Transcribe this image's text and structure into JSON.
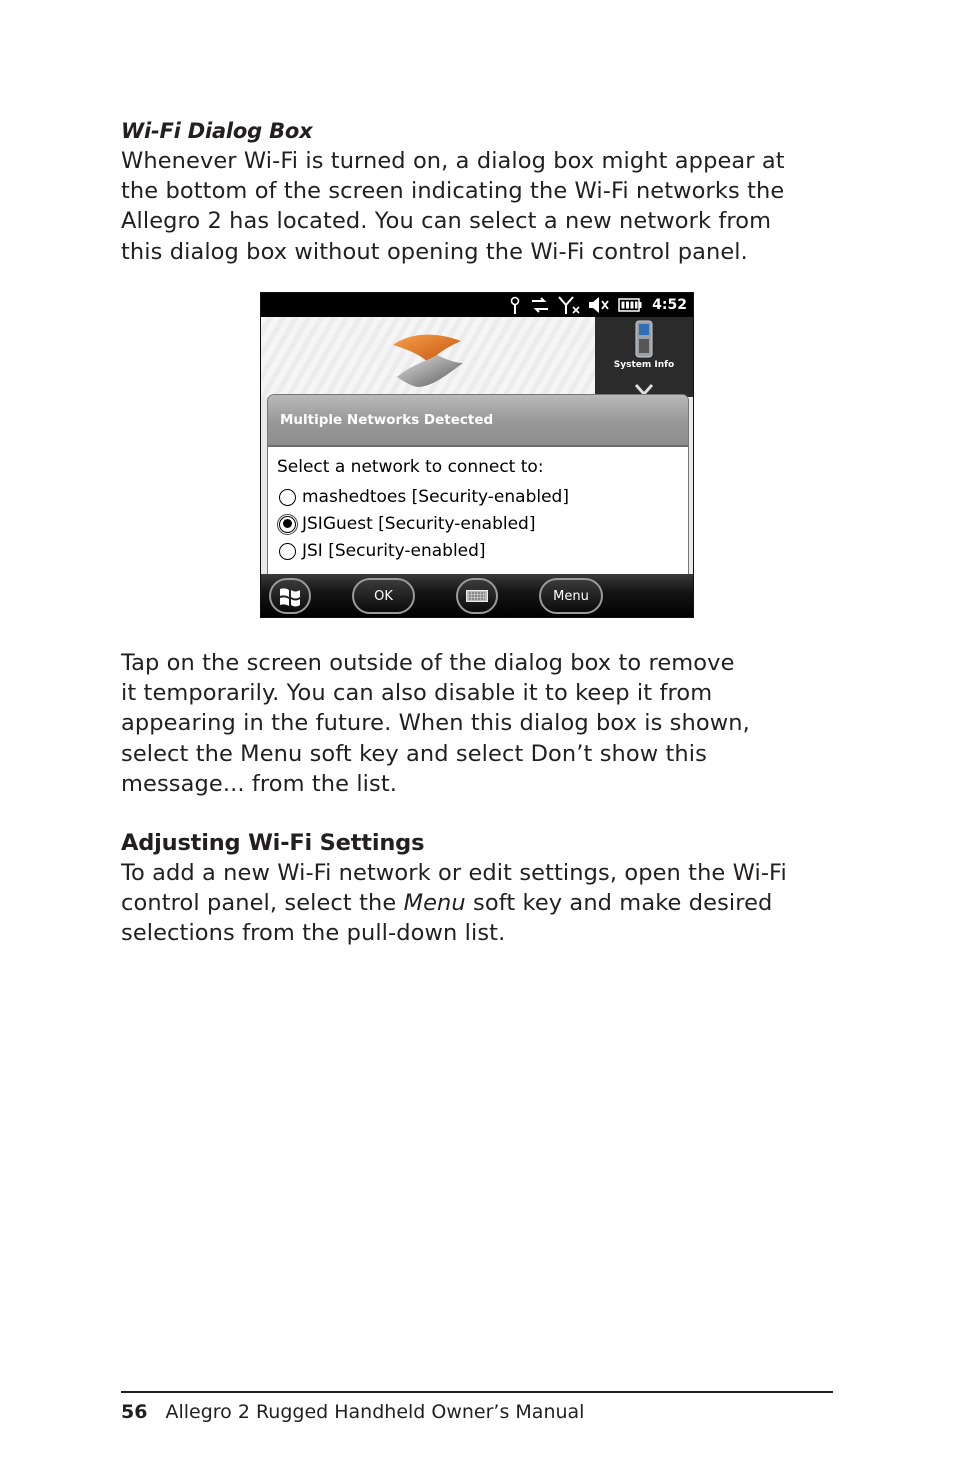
{
  "section": {
    "subheading": "Wi-Fi Dialog Box",
    "paragraph1": "Whenever Wi-Fi is turned on, a dialog box might appear at\nthe bottom of the screen indicating the Wi-Fi networks the\nAllegro 2 has located. You can select a new network from\nthis dialog box without opening the Wi-Fi control panel.",
    "paragraph2": "Tap on the screen outside of the dialog box to remove\nit temporarily. You can also disable it to keep it from\nappearing in the future. When this dialog box is shown,\nselect the Menu soft key and select Don’t show this\nmessage... from the list."
  },
  "section2": {
    "heading": "Adjusting Wi-Fi Settings",
    "p3_before": "To add a new Wi-Fi network or edit settings, open the Wi-Fi\ncontrol panel, select the ",
    "p3_italic": "Menu",
    "p3_after": " soft key and make desired\nselections from the pull-down list."
  },
  "device": {
    "status": {
      "time": "4:52",
      "icons": [
        "antenna-icon",
        "sync-arrows-icon",
        "no-signal-icon",
        "speaker-muted-icon",
        "battery-icon"
      ]
    },
    "today": {
      "system_info_label": "System Info"
    },
    "dialog": {
      "title": "Multiple Networks Detected",
      "prompt": "Select a network to connect to:",
      "networks": [
        {
          "label": "mashedtoes [Security-enabled]",
          "selected": false
        },
        {
          "label": "JSIGuest [Security-enabled]",
          "selected": true
        },
        {
          "label": "JSI [Security-enabled]",
          "selected": false
        }
      ]
    },
    "softkeys": {
      "ok": "OK",
      "menu": "Menu"
    }
  },
  "footer": {
    "page_number": "56",
    "title": "Allegro 2 Rugged Handheld Owner’s Manual"
  }
}
